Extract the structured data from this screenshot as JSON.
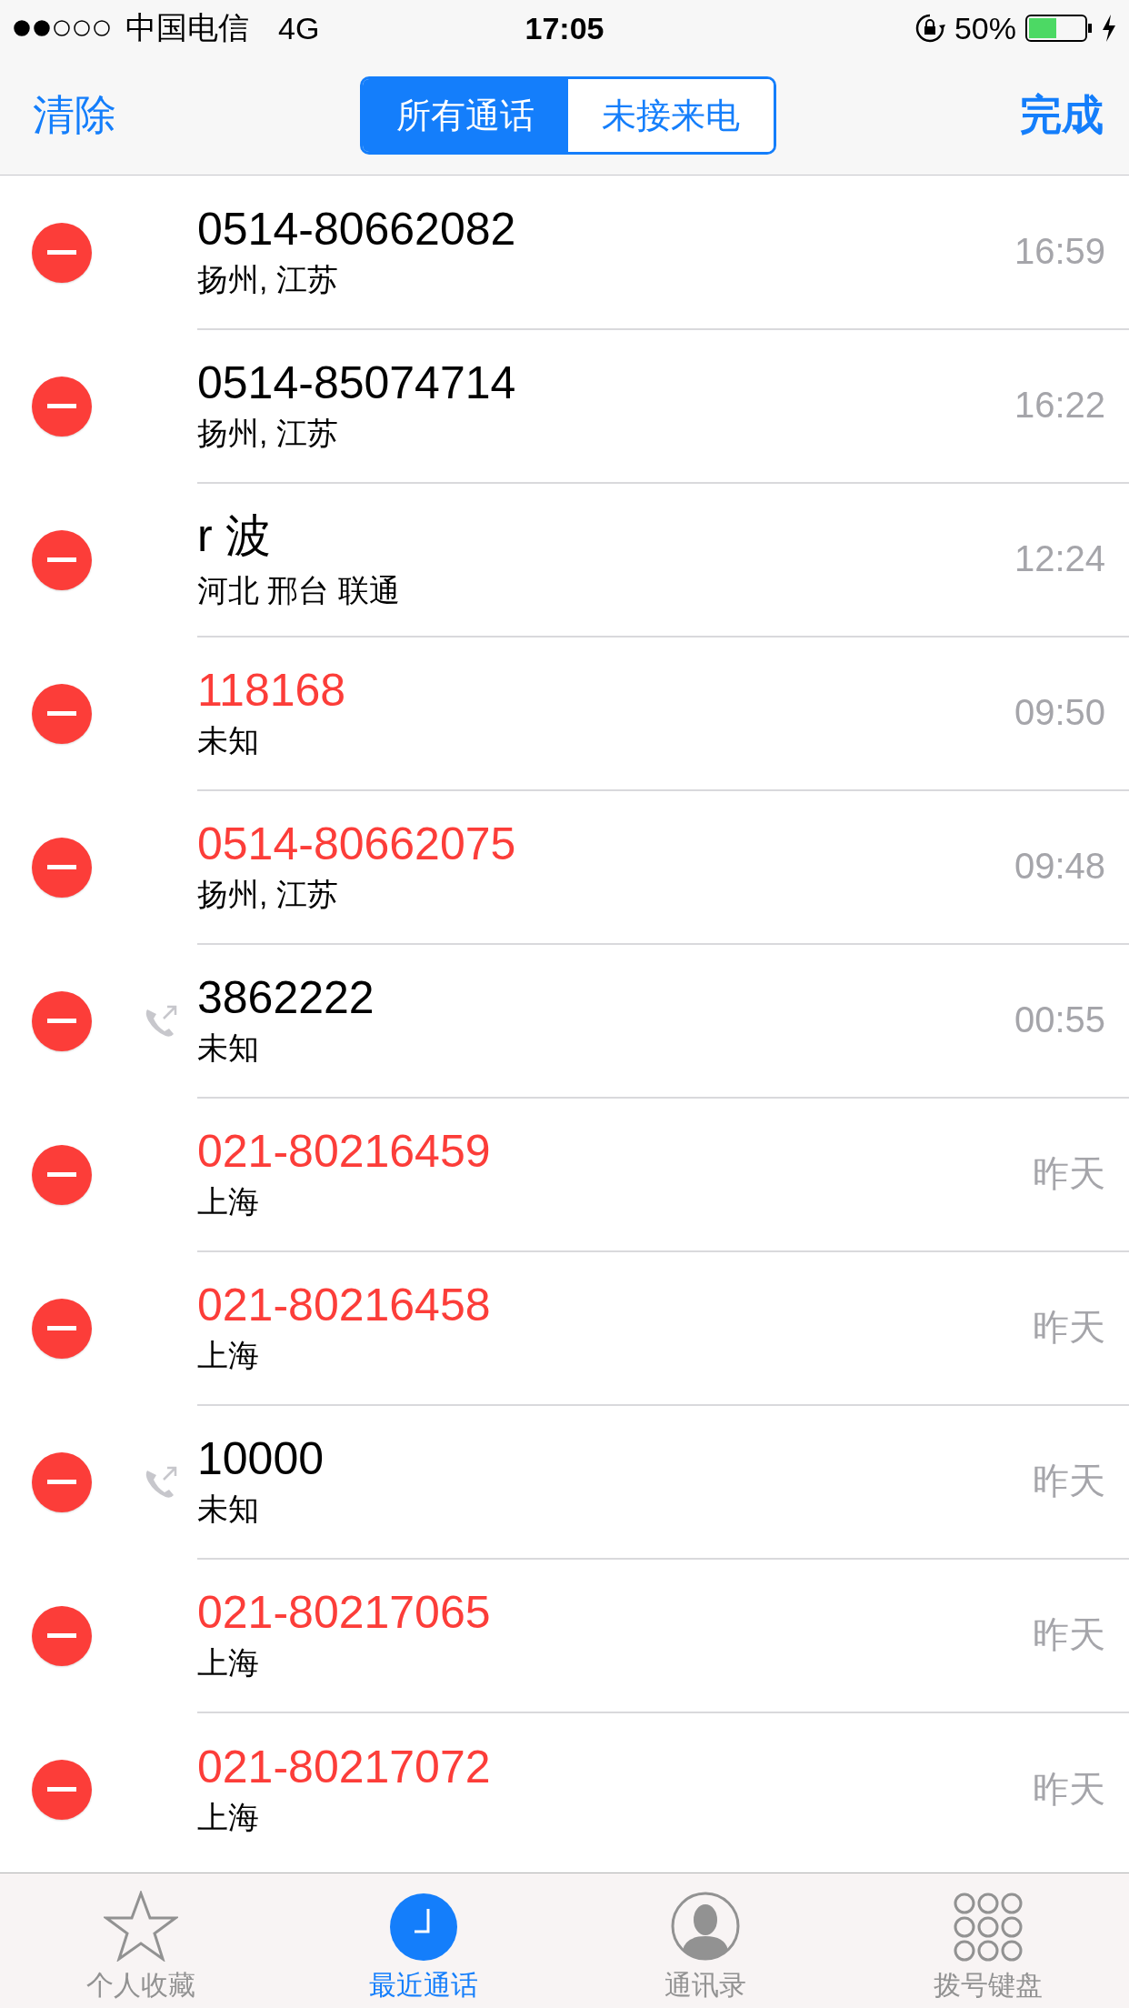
{
  "status_bar": {
    "carrier": "中国电信",
    "network": "4G",
    "time": "17:05",
    "battery": "50%"
  },
  "nav_bar": {
    "left_button": "清除",
    "right_button": "完成",
    "segments": [
      {
        "label": "所有通话",
        "selected": true
      },
      {
        "label": "未接来电",
        "selected": false
      }
    ]
  },
  "calls": [
    {
      "name": "0514-80662082",
      "location": "扬州, 江苏",
      "time": "16:59",
      "missed": false,
      "outgoing": false
    },
    {
      "name": "0514-85074714",
      "location": "扬州, 江苏",
      "time": "16:22",
      "missed": false,
      "outgoing": false
    },
    {
      "name": "r 波",
      "location": "河北 邢台 联通",
      "time": "12:24",
      "missed": false,
      "outgoing": false
    },
    {
      "name": "118168",
      "location": "未知",
      "time": "09:50",
      "missed": true,
      "outgoing": false
    },
    {
      "name": "0514-80662075",
      "location": "扬州, 江苏",
      "time": "09:48",
      "missed": true,
      "outgoing": false
    },
    {
      "name": "3862222",
      "location": "未知",
      "time": "00:55",
      "missed": false,
      "outgoing": true
    },
    {
      "name": "021-80216459",
      "location": "上海",
      "time": "昨天",
      "missed": true,
      "outgoing": false
    },
    {
      "name": "021-80216458",
      "location": "上海",
      "time": "昨天",
      "missed": true,
      "outgoing": false
    },
    {
      "name": "10000",
      "location": "未知",
      "time": "昨天",
      "missed": false,
      "outgoing": true
    },
    {
      "name": "021-80217065",
      "location": "上海",
      "time": "昨天",
      "missed": true,
      "outgoing": false
    },
    {
      "name": "021-80217072",
      "location": "上海",
      "time": "昨天",
      "missed": true,
      "outgoing": false
    }
  ],
  "tab_bar": [
    {
      "kind": "star",
      "label": "个人收藏",
      "selected": false
    },
    {
      "kind": "clock",
      "label": "最近通话",
      "selected": true
    },
    {
      "kind": "contact",
      "label": "通讯录",
      "selected": false
    },
    {
      "kind": "keypad",
      "label": "拨号键盘",
      "selected": false
    }
  ]
}
